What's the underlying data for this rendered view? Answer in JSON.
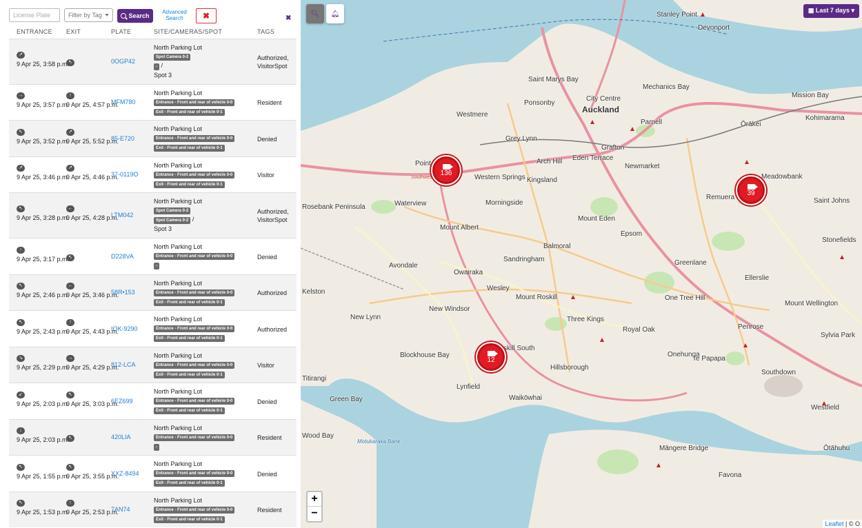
{
  "toolbar": {
    "license_plate_placeholder": "License Plate",
    "filter_by_tag": "Filter by Tag",
    "search_label": "Search",
    "advanced_search": "Advanced Search",
    "clear_icon": "x-icon",
    "close_icon": "close-icon"
  },
  "columns": {
    "entrance": "ENTRANCE",
    "exit": "EXIT",
    "plate": "PLATE",
    "site": "SITE/CAMERAS/SPOT",
    "tags": "TAGS"
  },
  "rows": [
    {
      "entrance": "9 Apr 25, 3:58 p.m.",
      "exit": "",
      "plate": "0OGP42",
      "site": "North Parking Lot",
      "badges": [
        "Spot Camera 0-2",
        "-"
      ],
      "spot": "Spot 3",
      "tags": "Authorized, VisitorSpot"
    },
    {
      "entrance": "9 Apr 25, 3:57 p.m.",
      "exit": "9 Apr 25, 4:57 p.m.",
      "plate": "MFM780",
      "site": "North Parking Lot",
      "badges": [
        "Entrance - Front and rear of vehicle 0-0",
        "Exit - Front and rear of vehicle 0-1"
      ],
      "spot": "",
      "tags": "Resident"
    },
    {
      "entrance": "9 Apr 25, 3:52 p.m.",
      "exit": "9 Apr 25, 5:52 p.m.",
      "plate": "85-E720",
      "site": "North Parking Lot",
      "badges": [
        "Entrance - Front and rear of vehicle 0-0",
        "Exit - Front and rear of vehicle 0-1"
      ],
      "spot": "",
      "tags": "Denied"
    },
    {
      "entrance": "9 Apr 25, 3:46 p.m.",
      "exit": "9 Apr 25, 4:46 p.m.",
      "plate": "37-0119O",
      "site": "North Parking Lot",
      "badges": [
        "Entrance - Front and rear of vehicle 0-0",
        "Exit - Front and rear of vehicle 0-1"
      ],
      "spot": "",
      "tags": "Visitor"
    },
    {
      "entrance": "9 Apr 25, 3:28 p.m.",
      "exit": "9 Apr 25, 4:28 p.m.",
      "plate": "LTM042",
      "site": "North Parking Lot",
      "badges": [
        "Spot Camera 0-2",
        "Spot Camera 0-2"
      ],
      "spot": "Spot 3",
      "tags": "Authorized, VisitorSpot"
    },
    {
      "entrance": "9 Apr 25, 3:17 p.m.",
      "exit": "",
      "plate": "D228VA",
      "site": "North Parking Lot",
      "badges": [
        "Entrance - Front and rear of vehicle 0-0",
        "-"
      ],
      "spot": "",
      "tags": "Denied"
    },
    {
      "entrance": "9 Apr 25, 2:46 p.m.",
      "exit": "9 Apr 25, 3:46 p.m.",
      "plate": "58R•153",
      "site": "North Parking Lot",
      "badges": [
        "Entrance - Front and rear of vehicle 0-0",
        "Exit - Front and rear of vehicle 0-1"
      ],
      "spot": "",
      "tags": "Authorized"
    },
    {
      "entrance": "9 Apr 25, 2:43 p.m.",
      "exit": "9 Apr 25, 4:43 p.m.",
      "plate": "IOK-9290",
      "site": "North Parking Lot",
      "badges": [
        "Entrance - Front and rear of vehicle 0-0",
        "Exit - Front and rear of vehicle 0-1"
      ],
      "spot": "",
      "tags": "Authorized"
    },
    {
      "entrance": "9 Apr 25, 2:29 p.m.",
      "exit": "9 Apr 25, 4:29 p.m.",
      "plate": "812-LCA",
      "site": "North Parking Lot",
      "badges": [
        "Entrance - Front and rear of vehicle 0-0",
        "Exit - Front and rear of vehicle 0-1"
      ],
      "spot": "",
      "tags": "Visitor"
    },
    {
      "entrance": "9 Apr 25, 2:03 p.m.",
      "exit": "9 Apr 25, 3:03 p.m.",
      "plate": "6EZ699",
      "site": "North Parking Lot",
      "badges": [
        "Entrance - Front and rear of vehicle 0-0",
        "Exit - Front and rear of vehicle 0-1"
      ],
      "spot": "",
      "tags": "Denied"
    },
    {
      "entrance": "9 Apr 25, 2:03 p.m.",
      "exit": "",
      "plate": "420LIA",
      "site": "North Parking Lot",
      "badges": [
        "Entrance - Front and rear of vehicle 0-0",
        "-"
      ],
      "spot": "",
      "tags": "Resident"
    },
    {
      "entrance": "9 Apr 25, 1:55 p.m.",
      "exit": "9 Apr 25, 3:55 p.m.",
      "plate": "XXZ-8494",
      "site": "North Parking Lot",
      "badges": [
        "Entrance - Front and rear of vehicle 0-0",
        "Exit - Front and rear of vehicle 0-1"
      ],
      "spot": "",
      "tags": "Denied"
    },
    {
      "entrance": "9 Apr 25, 1:53 p.m.",
      "exit": "9 Apr 25, 2:53 p.m.",
      "plate": "7AN74",
      "site": "North Parking Lot",
      "badges": [
        "Entrance - Front and rear of vehicle 0-0",
        "Exit - Front and rear of vehicle 0-1"
      ],
      "spot": "",
      "tags": "Resident"
    }
  ],
  "map": {
    "date_range": "Last 7 days",
    "clusters": [
      "136",
      "39",
      "12"
    ],
    "zoom_in": "+",
    "zoom_out": "−",
    "attribution_leaflet": "Leaflet",
    "attribution_rest": "| © O",
    "labels": {
      "auckland": "Auckland",
      "city_centre": "City Centre",
      "ponsonby": "Ponsonby",
      "westmere": "Westmere",
      "grey_lynn": "Grey Lynn",
      "parnell": "Parnell",
      "newmarket": "Newmarket",
      "grafton": "Grafton",
      "eden_terrace": "Eden Terrace",
      "arch_hill": "Arch Hill",
      "kingsland": "Kingsland",
      "western_springs": "Western Springs",
      "point": "Point",
      "waterview": "Waterview",
      "rosebank": "Rosebank Peninsula",
      "morningside": "Morningside",
      "mount_albert": "Mount Albert",
      "mount_eden": "Mount Eden",
      "epsom": "Epsom",
      "remuera": "Remuera",
      "meadowbank": "Meadowbank",
      "orakei": "Ōrākei",
      "kohimarama": "Kohimarama",
      "mission_bay": "Mission Bay",
      "saint_johns": "Saint Johns",
      "stonefields": "Stonefields",
      "balmoral": "Balmoral",
      "sandringham": "Sandringham",
      "greenlane": "Greenlane",
      "ellerslie": "Ellerslie",
      "avondale": "Avondale",
      "owairaka": "Owairaka",
      "wesley": "Wesley",
      "mount_roskill": "Mount Roskill",
      "one_tree_hill": "One Tree Hill",
      "mount_wellington": "Mount Wellington",
      "new_windsor": "New Windsor",
      "new_lynn": "New Lynn",
      "three_kings": "Three Kings",
      "royal_oak": "Royal Oak",
      "onehunga": "Onehunga",
      "penrose": "Penrose",
      "sylvia_park": "Sylvia Park",
      "te_papapa": "Te Papapa",
      "blockhouse_bay": "Blockhouse Bay",
      "lynfield": "Lynfield",
      "waikowhai": "Waikōwhai",
      "hillsborough": "Hillsborough",
      "roskill_south": "skill South",
      "southdown": "Southdown",
      "westfield": "Westfield",
      "otahuhu": "Ōtāhuhu",
      "mangere_bridge": "Māngere Bridge",
      "favona": "Favona",
      "green_bay": "Green Bay",
      "titirangi": "Titirangi",
      "wood_bay": "Wood Bay",
      "stanley_point": "Stanley Point",
      "devonport": "Devonport",
      "saint_marys_bay": "Saint Marys Bay",
      "mechanics_bay": "Mechanics Bay",
      "kelston": "Kelston",
      "motukaraka": "Motukaraka Bank",
      "southwestern": "Southwestern",
      "highway": "way"
    }
  },
  "colors": {
    "accent": "#5b2a86",
    "link": "#1e7fd6",
    "cluster": "#e01b24"
  }
}
